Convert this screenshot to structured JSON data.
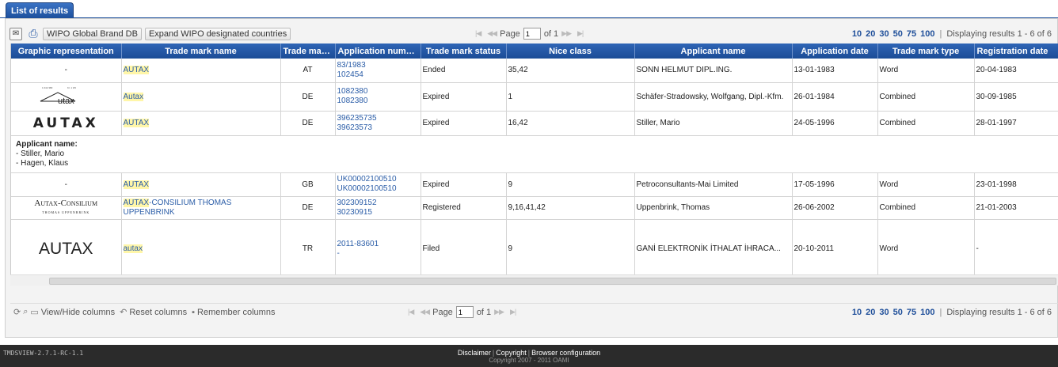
{
  "tab": {
    "label": "List of results"
  },
  "toolbar": {
    "wipo_btn": "WIPO Global Brand DB",
    "expand_btn": "Expand WIPO designated countries"
  },
  "pager": {
    "page_label": "Page",
    "page_value": "1",
    "of_label": "of 1"
  },
  "page_sizes": [
    "10",
    "20",
    "30",
    "50",
    "75",
    "100"
  ],
  "displaying": "Displaying results 1 - 6 of 6",
  "columns": [
    "Graphic representation",
    "Trade mark name",
    "Trade mark...",
    "Application numbe...",
    "Trade mark status",
    "Nice class",
    "Applicant name",
    "Application date",
    "Trade mark type",
    "Registration date"
  ],
  "rows": [
    {
      "graphic": "-",
      "name_hl": "AUTAX",
      "name_rest": "",
      "office": "AT",
      "app1": "83/1983",
      "app2": "102454",
      "status": "Ended",
      "nice": "35,42",
      "applicant": "SONN HELMUT DIPL.ING.",
      "app_date": "13-01-1983",
      "type": "Word",
      "reg_date": "20-04-1983"
    },
    {
      "graphic": "Autax",
      "name_hl": "Autax",
      "name_rest": "",
      "office": "DE",
      "app1": "1082380",
      "app2": "1082380",
      "status": "Expired",
      "nice": "1",
      "applicant": "Schäfer-Stradowsky, Wolfgang, Dipl.-Kfm.",
      "app_date": "26-01-1984",
      "type": "Combined",
      "reg_date": "30-09-1985"
    },
    {
      "graphic": "AUTAX",
      "name_hl": "AUTAX",
      "name_rest": "",
      "office": "DE",
      "app1": "396235735",
      "app2": "39623573",
      "status": "Expired",
      "nice": "16,42",
      "applicant": "Stiller, Mario",
      "app_date": "24-05-1996",
      "type": "Combined",
      "reg_date": "28-01-1997"
    },
    {
      "graphic": "-",
      "name_hl": "AUTAX",
      "name_rest": "",
      "office": "GB",
      "app1": "UK00002100510",
      "app2": "UK00002100510",
      "status": "Expired",
      "nice": "9",
      "applicant": "Petroconsultants-Mai Limited",
      "app_date": "17-05-1996",
      "type": "Word",
      "reg_date": "23-01-1998"
    },
    {
      "graphic": "Autax-Consilium",
      "name_hl": "AUTAX",
      "name_rest": "-CONSILIUM THOMAS UPPENBRINK",
      "office": "DE",
      "app1": "302309152",
      "app2": "30230915",
      "status": "Registered",
      "nice": "9,16,41,42",
      "applicant": "Uppenbrink, Thomas",
      "app_date": "26-06-2002",
      "type": "Combined",
      "reg_date": "21-01-2003"
    },
    {
      "graphic": "AUTAX",
      "name_hl": "autax",
      "name_rest": "",
      "office": "TR",
      "app1": "2011-83601",
      "app2": "-",
      "status": "Filed",
      "nice": "9",
      "applicant": "GANİ ELEKTRONİK İTHALAT İHRACA...",
      "app_date": "20-10-2011",
      "type": "Word",
      "reg_date": "-"
    }
  ],
  "expanded": {
    "title": "Applicant name:",
    "items": [
      "- Stiller, Mario",
      "- Hagen, Klaus"
    ]
  },
  "bottom": {
    "view_hide": "View/Hide columns",
    "reset": "Reset columns",
    "remember": "Remember columns"
  },
  "footer": {
    "version": "TMDSVIEW-2.7.1-RC-1.1",
    "links": [
      "Disclaimer",
      "Copyright",
      "Browser configuration"
    ],
    "copyright": "Copyright  2007 - 2011 OAMI"
  },
  "colors": {
    "header_blue": "#1c4f9c",
    "link": "#2c5ea8",
    "highlight": "#fff6a8"
  }
}
